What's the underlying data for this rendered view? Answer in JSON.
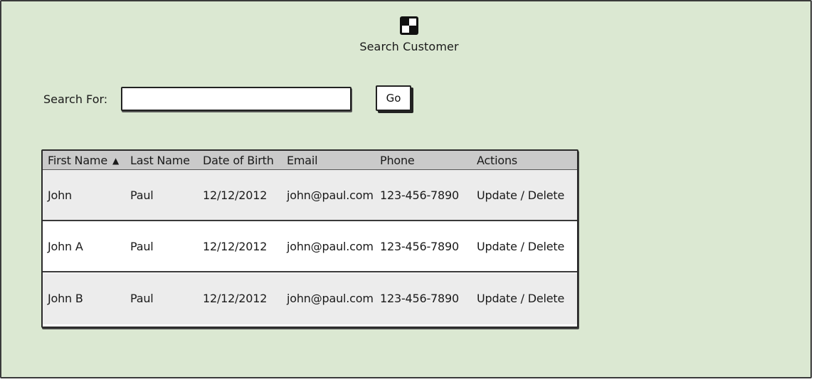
{
  "header": {
    "title": "Search Customer",
    "logo_icon": "image-placeholder-icon"
  },
  "search": {
    "label": "Search For:",
    "value": "",
    "placeholder": "",
    "button_label": "Go"
  },
  "table": {
    "sort_icon": "sort-ascending-icon",
    "columns": [
      "First Name",
      "Last Name",
      "Date of Birth",
      "Email",
      "Phone",
      "Actions"
    ],
    "sorted_column": "First Name",
    "sort_direction": "ascending",
    "rows": [
      {
        "first_name": "John",
        "last_name": "Paul",
        "dob": "12/12/2012",
        "email": "john@paul.com",
        "phone": "123-456-7890",
        "update": "Update",
        "separator": "/",
        "delete": "Delete"
      },
      {
        "first_name": "John A",
        "last_name": "Paul",
        "dob": "12/12/2012",
        "email": "john@paul.com",
        "phone": "123-456-7890",
        "update": "Update",
        "separator": "/",
        "delete": "Delete"
      },
      {
        "first_name": "John B",
        "last_name": "Paul",
        "dob": "12/12/2012",
        "email": "john@paul.com",
        "phone": "123-456-7890",
        "update": "Update",
        "separator": "/",
        "delete": "Delete"
      }
    ]
  },
  "colors": {
    "background": "#dbe8d2",
    "header_row": "#cacaca",
    "row_odd": "#ececec",
    "row_even": "#ffffff"
  }
}
